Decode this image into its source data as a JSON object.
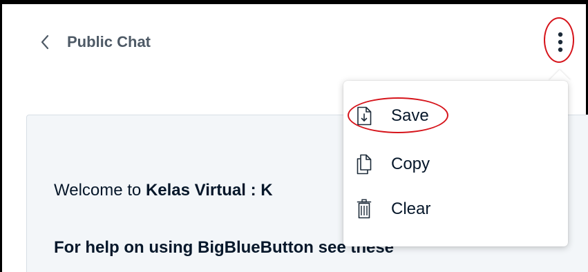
{
  "header": {
    "back_icon": "chevron-left-icon",
    "title": "Public Chat",
    "menu_icon": "more-vertical-icon"
  },
  "chat": {
    "welcome_prefix": "Welcome to ",
    "welcome_bold": "Kelas Virtual : K",
    "help_text": "For help on using BigBlueButton see these"
  },
  "menu": {
    "items": [
      {
        "label": "Save",
        "icon": "save-file-icon"
      },
      {
        "label": "Copy",
        "icon": "copy-icon"
      },
      {
        "label": "Clear",
        "icon": "trash-icon"
      }
    ]
  },
  "colors": {
    "annotation_red": "#d6141b",
    "title_gray": "#4e5a66",
    "text_dark": "#06172a",
    "panel_bg": "#f3f6f9"
  }
}
